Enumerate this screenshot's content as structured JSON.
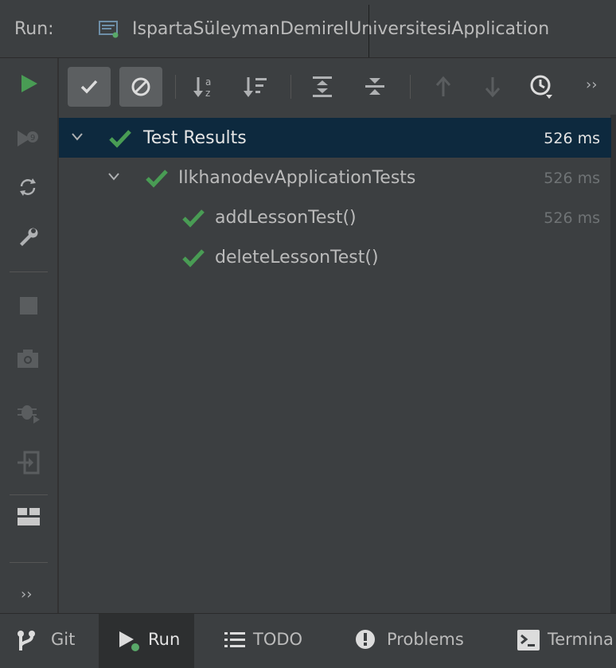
{
  "header": {
    "run_label": "Run:",
    "tab_title": "IspartaSüleymanDemirelUniversitesiApplication"
  },
  "toolbar": {
    "items": [
      "rerun-icon",
      "show-passed-icon",
      "show-ignored-icon",
      "sort-alphabetically-icon",
      "sort-by-duration-icon",
      "expand-all-icon",
      "collapse-all-icon",
      "previous-test-icon",
      "next-test-icon",
      "test-history-icon",
      "more-icon"
    ]
  },
  "left_toolbar": {
    "items": [
      "rerun-failed-icon",
      "toggle-auto-test-icon",
      "settings-wrench-icon",
      "stop-icon",
      "snapshot-icon",
      "debug-icon",
      "exit-icon",
      "layout-icon",
      "more-icon"
    ]
  },
  "tree": {
    "rows": [
      {
        "label": "Test Results",
        "time": "526 ms"
      },
      {
        "label": "IlkhanodevApplicationTests",
        "time": "526 ms"
      },
      {
        "label": "addLessonTest()",
        "time": "526 ms"
      },
      {
        "label": "deleteLessonTest()",
        "time": ""
      }
    ]
  },
  "bottom_bar": {
    "git": "Git",
    "run": "Run",
    "todo": "TODO",
    "problems": "Problems",
    "terminal": "Termina"
  },
  "colors": {
    "background": "#3c3f41",
    "selection": "#0d293e",
    "pass_green": "#499c54",
    "text": "#bbbbbb"
  }
}
